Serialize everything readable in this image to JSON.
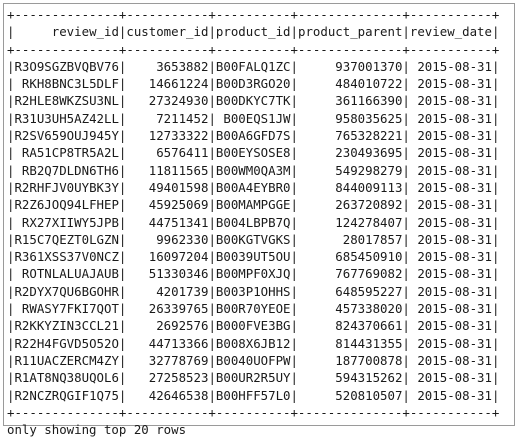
{
  "table": {
    "columns": [
      {
        "label": "review_id",
        "width": 14
      },
      {
        "label": "customer_id",
        "width": 11
      },
      {
        "label": "product_id",
        "width": 10
      },
      {
        "label": "product_parent",
        "width": 14
      },
      {
        "label": "review_date",
        "width": 11
      }
    ],
    "rows": [
      [
        "R3O9SGZBVQBV76",
        "3653882",
        "B00FALQ1ZC",
        "937001370",
        "2015-08-31"
      ],
      [
        "RKH8BNC3L5DLF",
        "14661224",
        "B00D3RGO20",
        "484010722",
        "2015-08-31"
      ],
      [
        "R2HLE8WKZSU3NL",
        "27324930",
        "B00DKYC7TK",
        "361166390",
        "2015-08-31"
      ],
      [
        "R31U3UH5AZ42LL",
        "7211452",
        "B00EQS1JW",
        "958035625",
        "2015-08-31"
      ],
      [
        "R2SV659OUJ945Y",
        "12733322",
        "B00A6GFD7S",
        "765328221",
        "2015-08-31"
      ],
      [
        "RA51CP8TR5A2L",
        "6576411",
        "B00EYSOSE8",
        "230493695",
        "2015-08-31"
      ],
      [
        "RB2Q7DLDN6TH6",
        "11811565",
        "B00WM0QA3M",
        "549298279",
        "2015-08-31"
      ],
      [
        "R2RHFJV0UYBK3Y",
        "49401598",
        "B00A4EYBR0",
        "844009113",
        "2015-08-31"
      ],
      [
        "R2Z6JOQ94LFHEP",
        "45925069",
        "B00MAMPGGE",
        "263720892",
        "2015-08-31"
      ],
      [
        "RX27XIIWY5JPB",
        "44751341",
        "B004LBPB7Q",
        "124278407",
        "2015-08-31"
      ],
      [
        "R15C7QEZT0LGZN",
        "9962330",
        "B00KGTVGKS",
        "28017857",
        "2015-08-31"
      ],
      [
        "R361XSS37V0NCZ",
        "16097204",
        "B0039UT5OU",
        "685450910",
        "2015-08-31"
      ],
      [
        "ROTNLALUAJAUB",
        "51330346",
        "B00MPF0XJQ",
        "767769082",
        "2015-08-31"
      ],
      [
        "R2DYX7QU6BGOHR",
        "4201739",
        "B003P1OHHS",
        "648595227",
        "2015-08-31"
      ],
      [
        "RWASY7FKI7QOT",
        "26339765",
        "B00R70YEOE",
        "457338020",
        "2015-08-31"
      ],
      [
        "R2KKYZIN3CCL21",
        "2692576",
        "B000FVE3BG",
        "824370661",
        "2015-08-31"
      ],
      [
        "R22H4FGVD5O52O",
        "44713366",
        "B008X6JB12",
        "814431355",
        "2015-08-31"
      ],
      [
        "R11UACZERCM4ZY",
        "32778769",
        "B0040UOFPW",
        "187700878",
        "2015-08-31"
      ],
      [
        "R1AT8NQ38UQOL6",
        "27258523",
        "B00UR2R5UY",
        "594315262",
        "2015-08-31"
      ],
      [
        "R2NCZRQGIF1Q75",
        "42646538",
        "B00HFF57L0",
        "520810507",
        "2015-08-31"
      ]
    ],
    "footer": "only showing top 20 rows"
  }
}
